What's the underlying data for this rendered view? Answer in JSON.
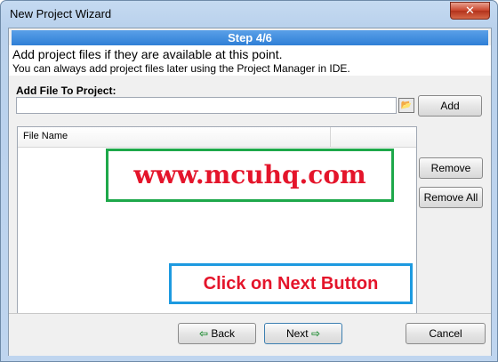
{
  "window": {
    "title": "New Project Wizard",
    "close_label": "✕"
  },
  "step": {
    "label": "Step 4/6"
  },
  "info": {
    "line1": "Add project files if they are available at this point.",
    "line2": "You can always add project files later using the Project Manager in IDE."
  },
  "add_file": {
    "label": "Add File To Project:",
    "value": "",
    "add_button": "Add"
  },
  "file_list": {
    "columns": [
      "File Name"
    ],
    "rows": []
  },
  "side_buttons": {
    "remove": "Remove",
    "remove_all": "Remove All"
  },
  "annotations": {
    "watermark": "www.mcuhq.com",
    "hint": "Click on Next Button"
  },
  "footer": {
    "back": "Back",
    "next": "Next",
    "cancel": "Cancel"
  },
  "icons": {
    "back": "arrow-left-icon",
    "next": "arrow-right-icon",
    "browse": "folder-browse-icon"
  },
  "colors": {
    "step_bar": "#2f7fd6",
    "watermark_border": "#1ea84a",
    "hint_border": "#1d9ae0",
    "annotation_text": "#e4152b"
  }
}
